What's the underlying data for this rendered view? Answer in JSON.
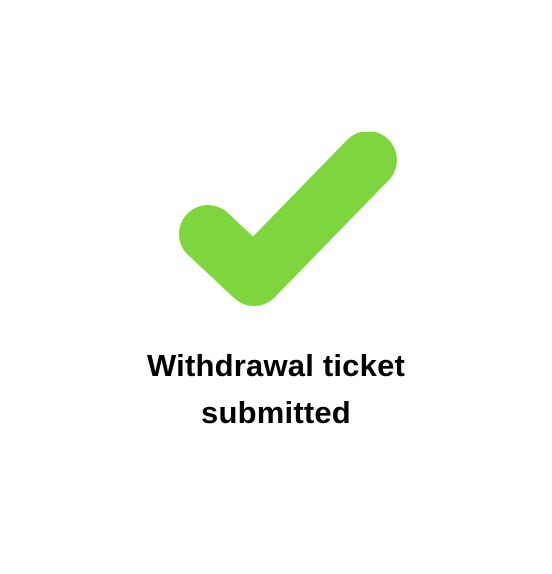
{
  "status": {
    "icon": "checkmark-icon",
    "icon_color": "#7ED63F",
    "message_line_1": "Withdrawal ticket",
    "message_line_2": "submitted"
  }
}
